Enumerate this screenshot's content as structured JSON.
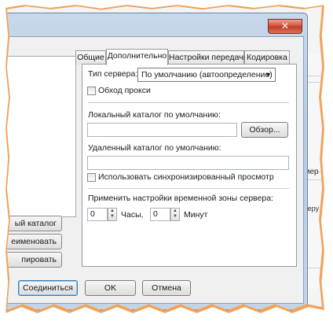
{
  "window": {
    "close_glyph": "✕"
  },
  "left_buttons": [
    "ый каталог",
    "еименовать",
    "пировать"
  ],
  "tabs": [
    "Общие",
    "Дополнительно",
    "Настройки передачи",
    "Кодировка"
  ],
  "advanced": {
    "server_type_label": "Тип сервера:",
    "server_type_value": "По умолчанию (автоопределение)",
    "bypass_proxy_label": "Обход прокси",
    "local_dir_label": "Локальный каталог по умолчанию:",
    "local_dir_value": "",
    "browse_label": "Обзор...",
    "remote_dir_label": "Удаленный каталог по умолчанию:",
    "remote_dir_value": "",
    "sync_browse_label": "Использовать синхронизированный просмотр",
    "timezone_label": "Применить настройки временной зоны сервера:",
    "hours_value": "0",
    "hours_label": "Часы,",
    "minutes_value": "0",
    "minutes_label": "Минут"
  },
  "dialog_buttons": {
    "connect": "Соединиться",
    "ok": "OK",
    "cancel": "Отмена"
  },
  "background": {
    "header_text": "змер",
    "cell_text": "веру"
  },
  "icons": {
    "close": "close-icon",
    "dropdown": "chevron-down-icon",
    "spin_up": "spin-up-icon",
    "spin_down": "spin-down-icon"
  }
}
